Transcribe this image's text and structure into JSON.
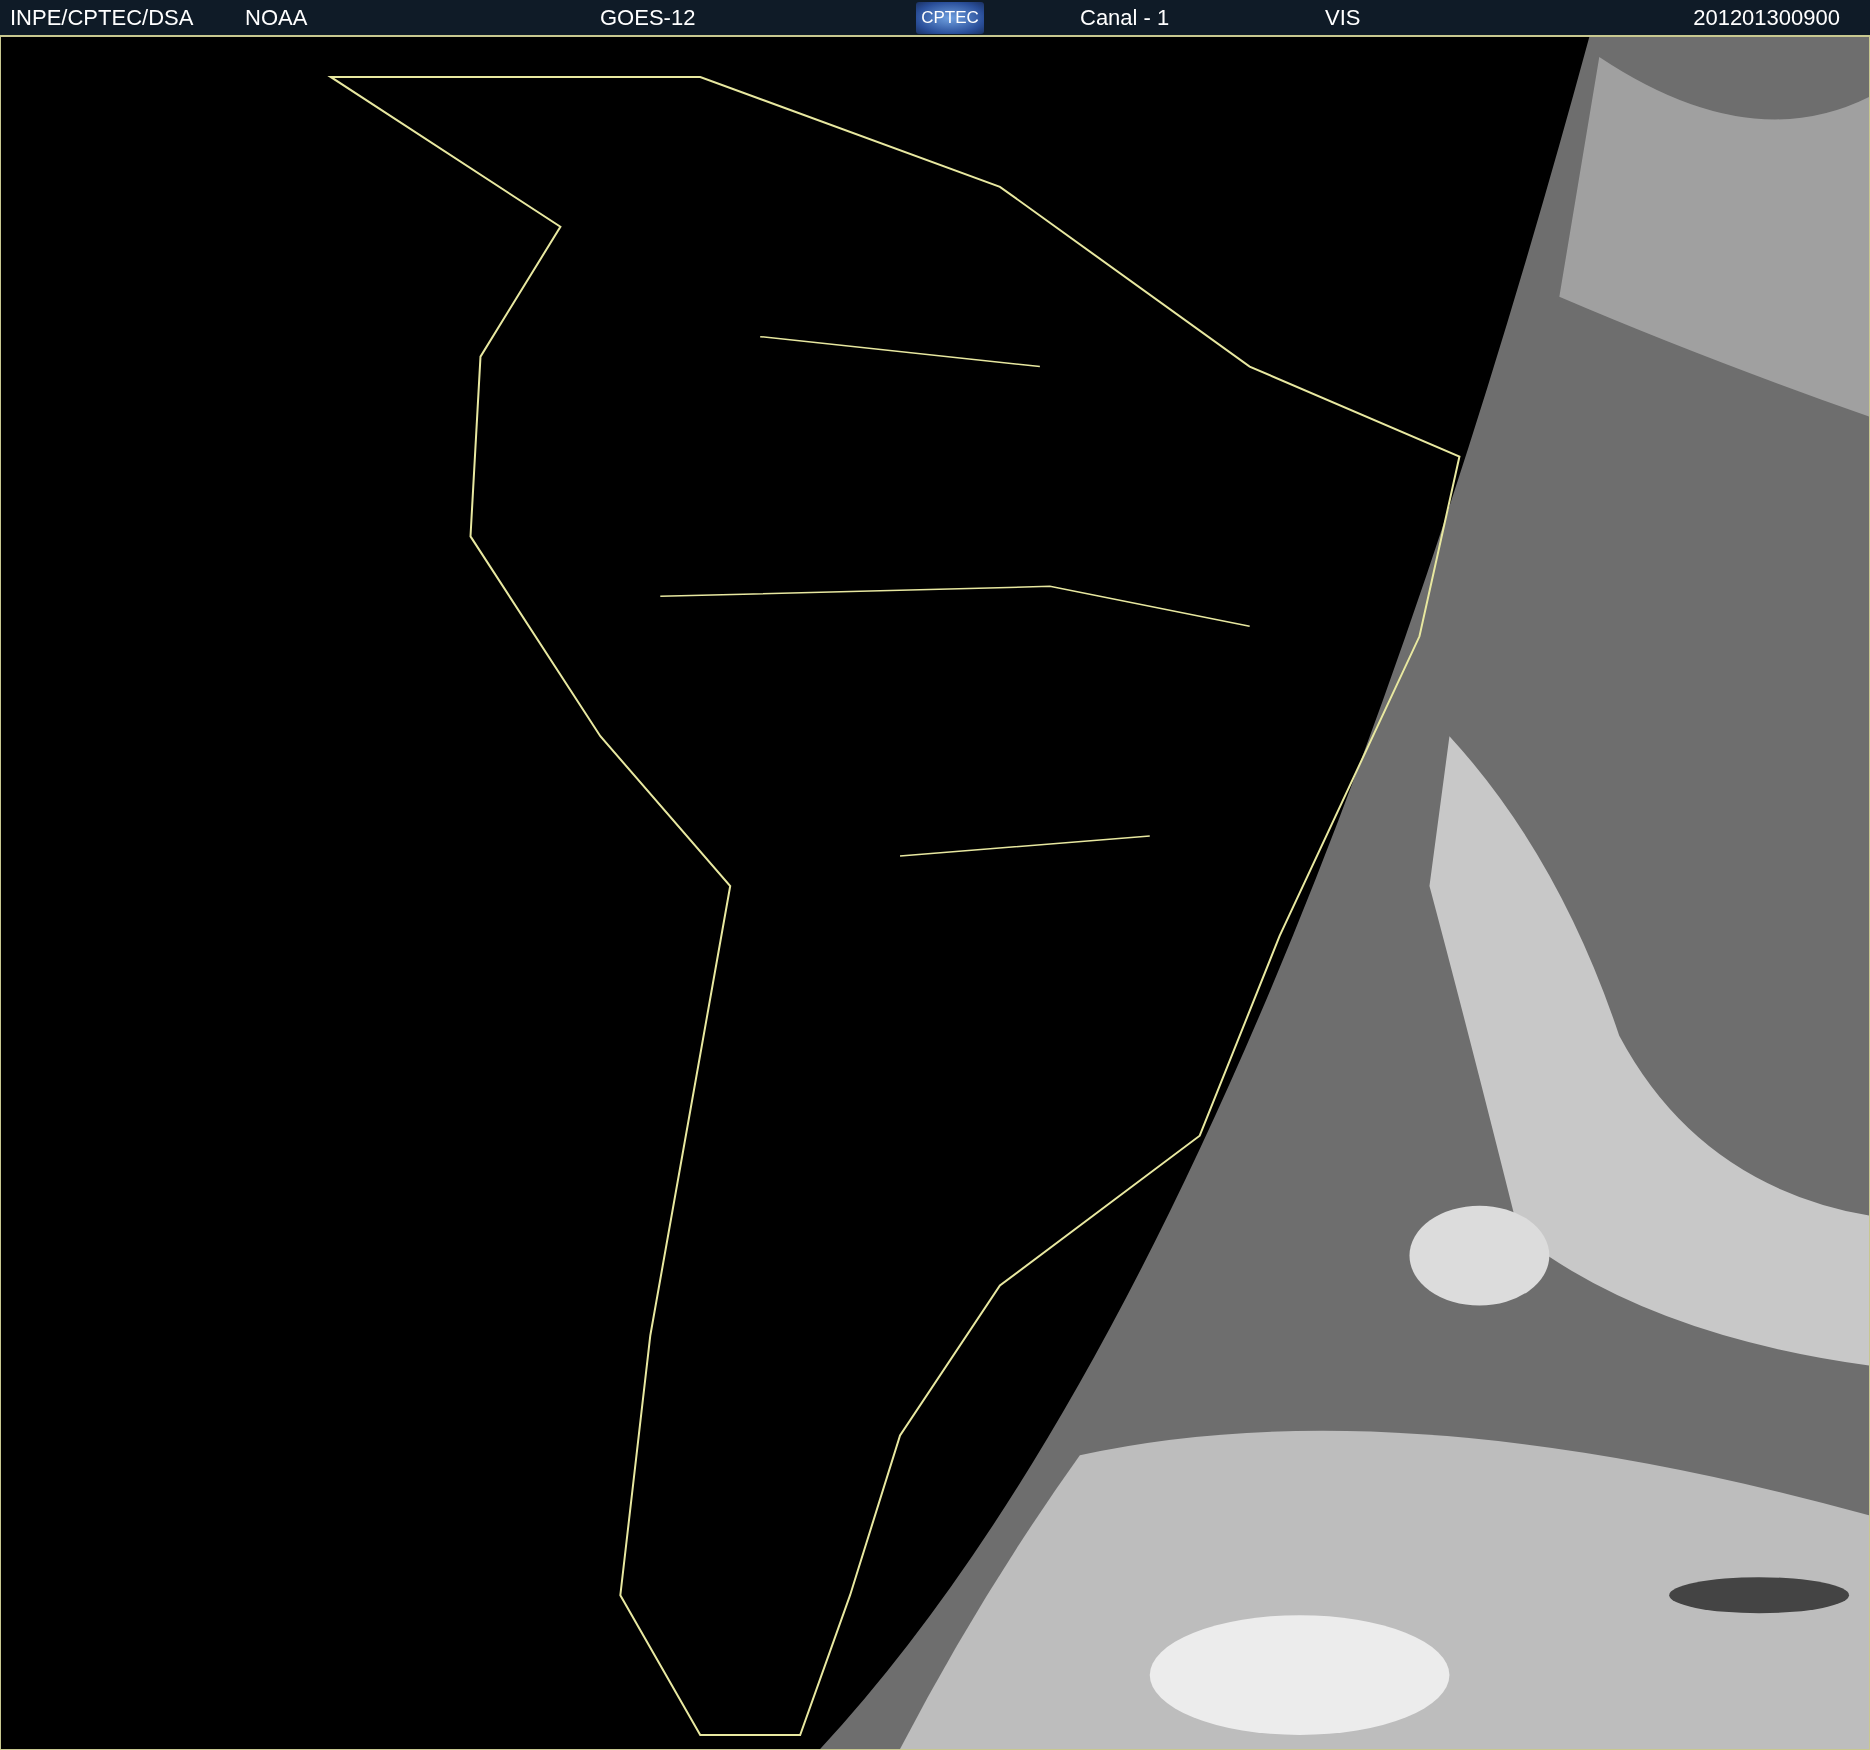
{
  "header": {
    "source": "INPE/CPTEC/DSA",
    "agency": "NOAA",
    "satellite": "GOES-12",
    "logo": "CPTEC",
    "channel": "Canal - 1",
    "band": "VIS",
    "timestamp": "201201300900"
  }
}
